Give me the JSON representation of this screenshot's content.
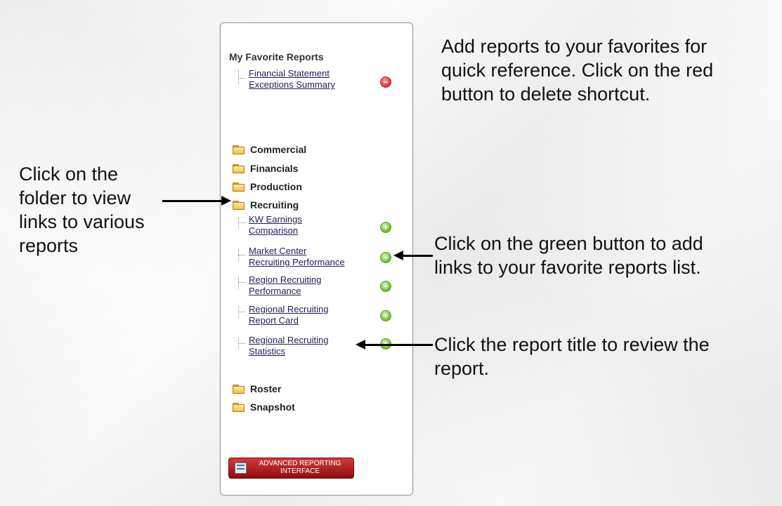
{
  "panel": {
    "favorites": {
      "title": "My Favorite Reports",
      "items": [
        {
          "line1": "Financial Statement",
          "line2": "Exceptions Summary",
          "action": "remove-icon"
        }
      ]
    },
    "folders": [
      {
        "label": "Commercial"
      },
      {
        "label": "Financials"
      },
      {
        "label": "Production"
      },
      {
        "label": "Recruiting",
        "expanded": true
      },
      {
        "label": "Roster"
      },
      {
        "label": "Snapshot"
      }
    ],
    "recruiting_reports": [
      {
        "line1": "KW Earnings",
        "line2": "Comparison"
      },
      {
        "line1": "Market Center",
        "line2": "Recruiting Performance"
      },
      {
        "line1": "Region Recruiting",
        "line2": "Performance"
      },
      {
        "line1": "Regional Recruiting",
        "line2": "Report Card"
      },
      {
        "line1": "Regional Recruiting",
        "line2": "Statistics"
      }
    ],
    "advanced_button": {
      "line1": "ADVANCED REPORTING",
      "line2": "INTERFACE"
    }
  },
  "callouts": {
    "favorites_tip": [
      "Add reports to your favorites for",
      "quick reference. Click on the red",
      "button to delete shortcut."
    ],
    "folder_tip": [
      "Click on the",
      "folder to view",
      "links to various",
      "reports"
    ],
    "green_tip": [
      "Click on the green button to add",
      "links to your favorite reports list."
    ],
    "title_tip": [
      "Click the report title to review the",
      "report."
    ]
  },
  "colors": {
    "remove_button": "#e23b3b",
    "add_button": "#79c23e",
    "advanced_button": "#b01f1f",
    "link_text": "#1f1f5a"
  }
}
